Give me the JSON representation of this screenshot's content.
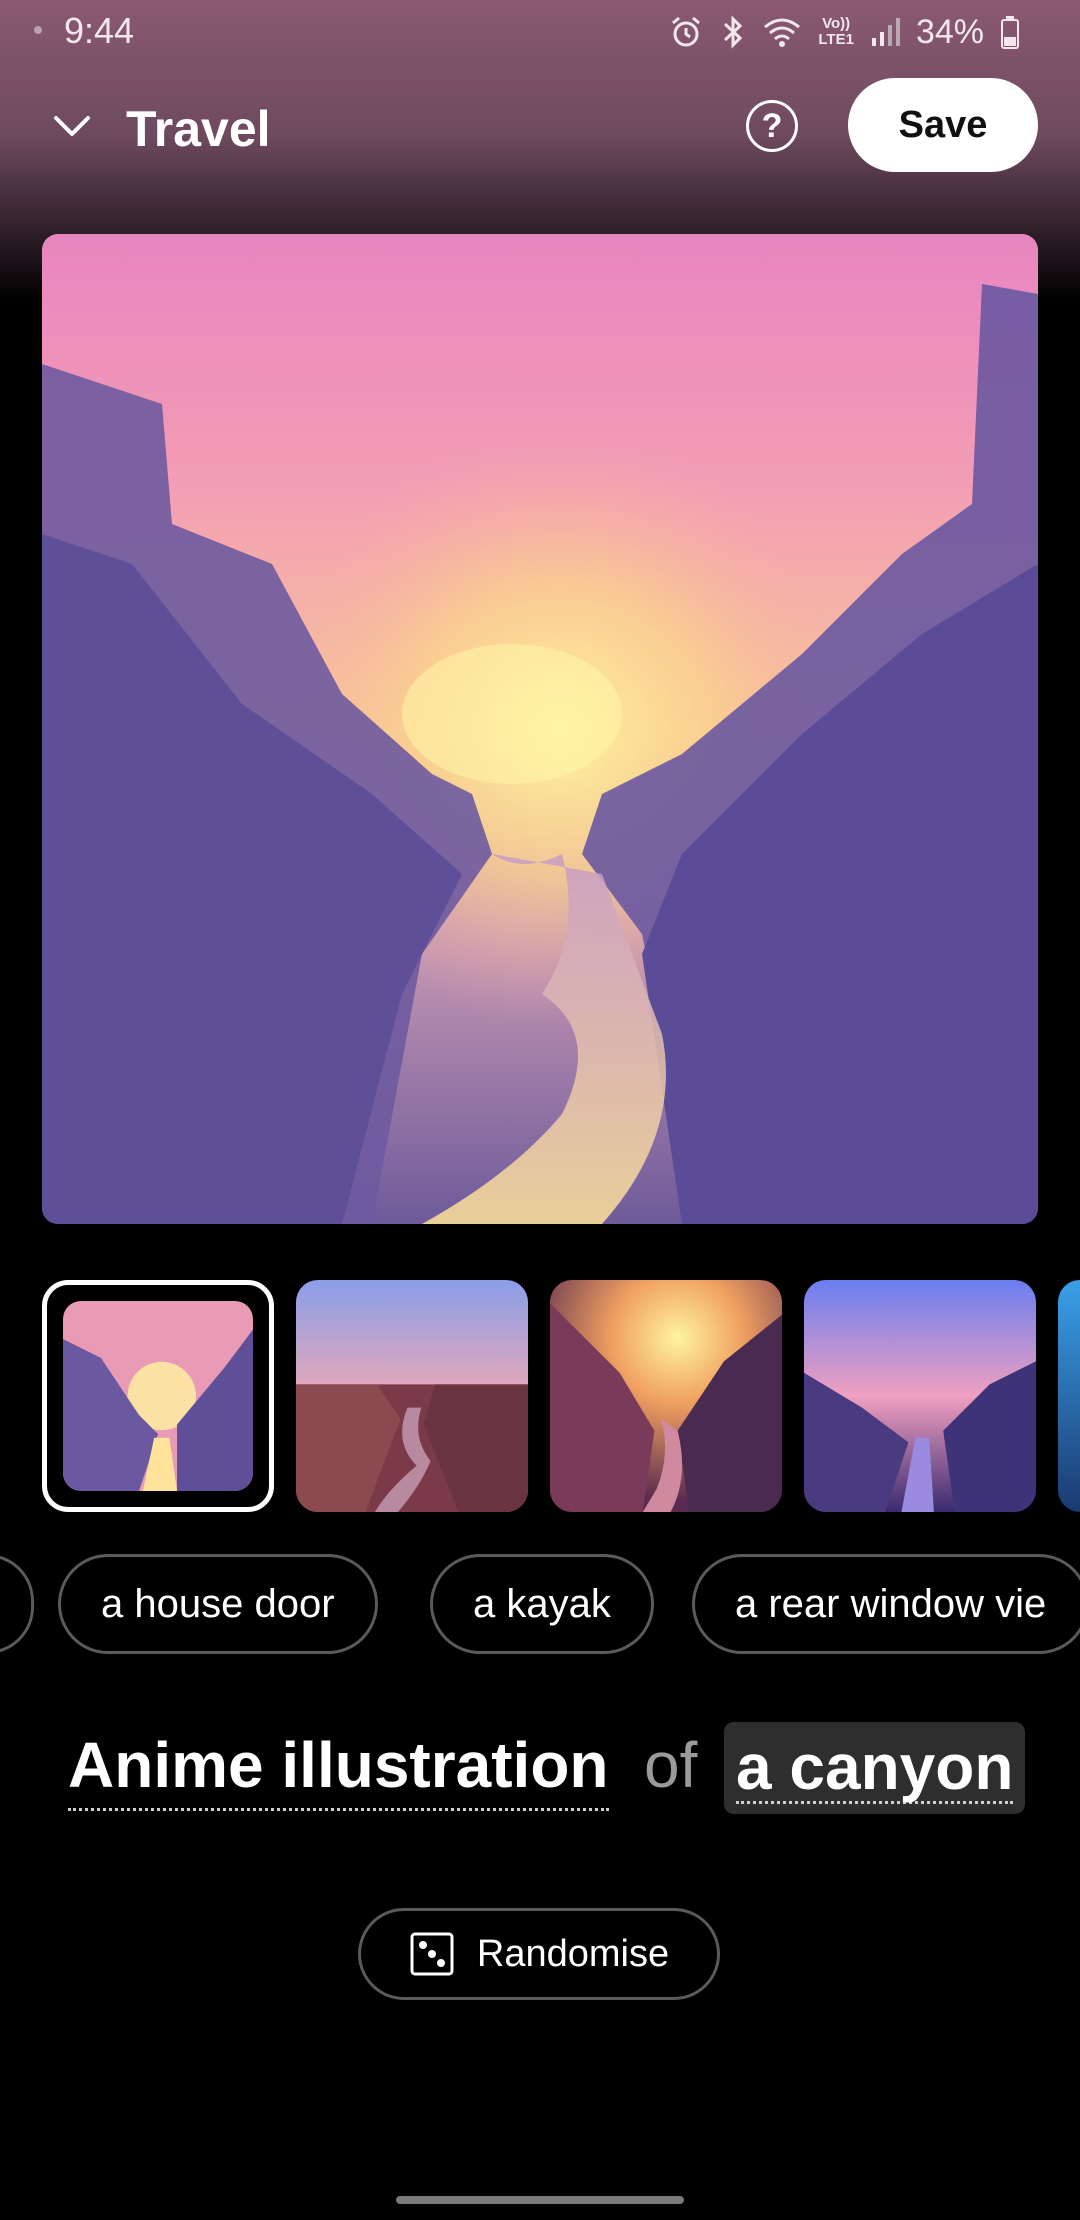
{
  "status_bar": {
    "time": "9:44",
    "network_label_top": "Vo))",
    "network_label_bottom": "LTE1",
    "battery": "34%",
    "icons": [
      "alarm-icon",
      "bluetooth-icon",
      "wifi-icon",
      "volte-icon",
      "signal-icon",
      "battery-icon"
    ]
  },
  "header": {
    "title": "Travel",
    "help_label": "?",
    "save_label": "Save"
  },
  "thumbnails": {
    "selected_index": 0,
    "count_visible": 5
  },
  "chips": [
    {
      "label": ""
    },
    {
      "label": "a house door"
    },
    {
      "label": "a kayak"
    },
    {
      "label": "a rear window vie"
    }
  ],
  "prompt": {
    "style": "Anime illustration",
    "connector": "of",
    "subject": "a canyon"
  },
  "actions": {
    "randomise_label": "Randomise"
  },
  "colors": {
    "background": "#000000",
    "header_gradient": "#8a5a72",
    "chip_border": "#5a5a5a",
    "subject_highlight": "#2e2e2e"
  }
}
